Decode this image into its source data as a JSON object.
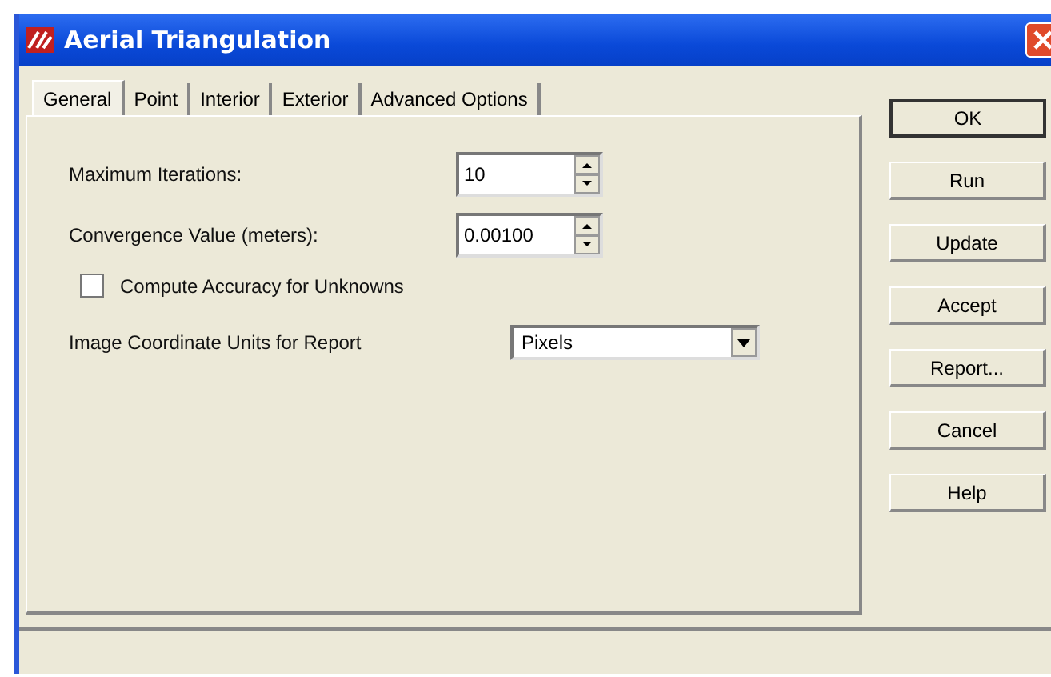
{
  "window": {
    "title": "Aerial Triangulation"
  },
  "tabs": [
    {
      "label": "General",
      "selected": true
    },
    {
      "label": "Point",
      "selected": false
    },
    {
      "label": "Interior",
      "selected": false
    },
    {
      "label": "Exterior",
      "selected": false
    },
    {
      "label": "Advanced Options",
      "selected": false
    }
  ],
  "fields": [
    {
      "label": "Maximum Iterations:",
      "value": "10"
    },
    {
      "label": "Convergence Value (meters):",
      "value": "0.00100"
    }
  ],
  "checkbox": {
    "label": "Compute Accuracy for Unknowns",
    "checked": false
  },
  "dropdown": {
    "label": "Image Coordinate Units for Report",
    "value": "Pixels"
  },
  "buttons": [
    {
      "label": "OK",
      "default": true
    },
    {
      "label": "Run",
      "default": false
    },
    {
      "label": "Update",
      "default": false
    },
    {
      "label": "Accept",
      "default": false
    },
    {
      "label": "Report...",
      "default": false
    },
    {
      "label": "Cancel",
      "default": false
    },
    {
      "label": "Help",
      "default": false
    }
  ]
}
